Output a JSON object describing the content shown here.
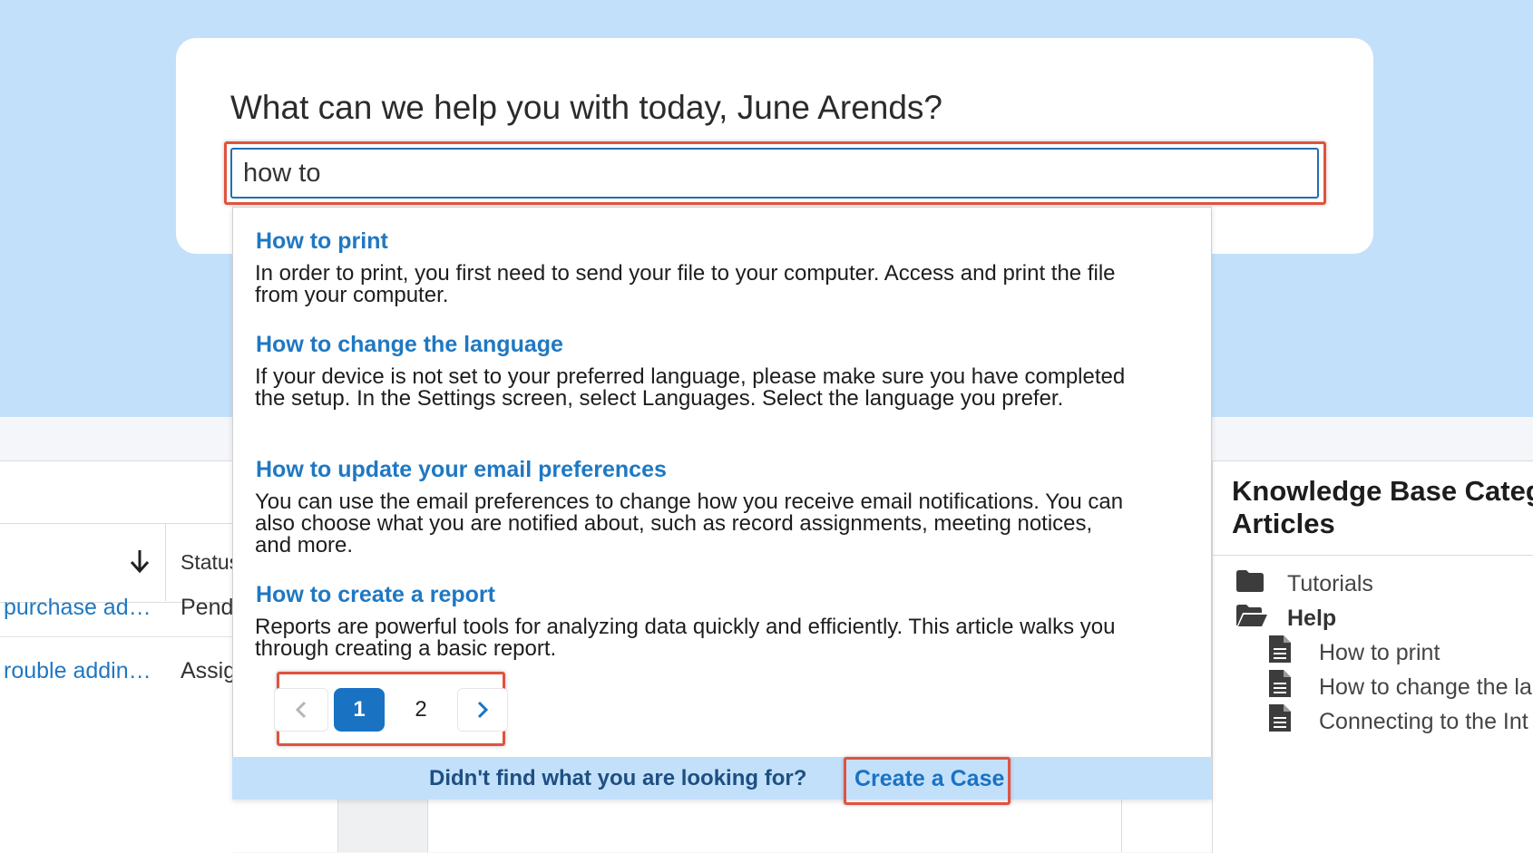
{
  "search": {
    "greeting": "What can we help you with today, June Arends?",
    "query": "how to"
  },
  "results": [
    {
      "title": "How to print",
      "description": "In order to print, you first need to send your file to your computer. Access and print the file from your computer."
    },
    {
      "title": "How to change the language",
      "description": "If your device is not set to your preferred language, please make sure you have completed the setup. In the Settings screen, select Languages. Select the language you prefer."
    },
    {
      "title": "How to update your email preferences",
      "description": "You can use the email preferences to change how you receive email notifications. You can also choose what you are notified about, such as record assignments, meeting notices, and more."
    },
    {
      "title": "How to create a report",
      "description": "Reports are powerful tools for analyzing data quickly and efficiently. This article walks you through creating a basic report."
    }
  ],
  "pagination": {
    "prev_icon": "chevron-left-icon",
    "pages": [
      "1",
      "2"
    ],
    "current": "1",
    "next_icon": "chevron-right-icon"
  },
  "footer": {
    "prompt": "Didn't find what you are looking for?",
    "create_case": "Create a Case"
  },
  "background_table": {
    "status_header": "Status",
    "rows": [
      {
        "subject": "purchase ad…",
        "status": "Pend"
      },
      {
        "subject": "rouble addin…",
        "status": "Assig"
      }
    ]
  },
  "kb_panel": {
    "title_line1": "Knowledge Base Catego",
    "title_line2": "Articles",
    "tree": [
      {
        "label": "Tutorials",
        "icon": "folder-icon",
        "bold": false
      },
      {
        "label": "Help",
        "icon": "folder-open-icon",
        "bold": true
      },
      {
        "label": "How to print",
        "icon": "document-icon",
        "bold": false
      },
      {
        "label": "How to change the la",
        "icon": "document-icon",
        "bold": false
      },
      {
        "label": "Connecting to the Int",
        "icon": "document-icon",
        "bold": false
      }
    ]
  },
  "colors": {
    "hero_bg": "#c3e0fb",
    "link_blue": "#1f78c2",
    "accent_blue": "#1a72c2",
    "highlight_red": "#e0533f"
  }
}
